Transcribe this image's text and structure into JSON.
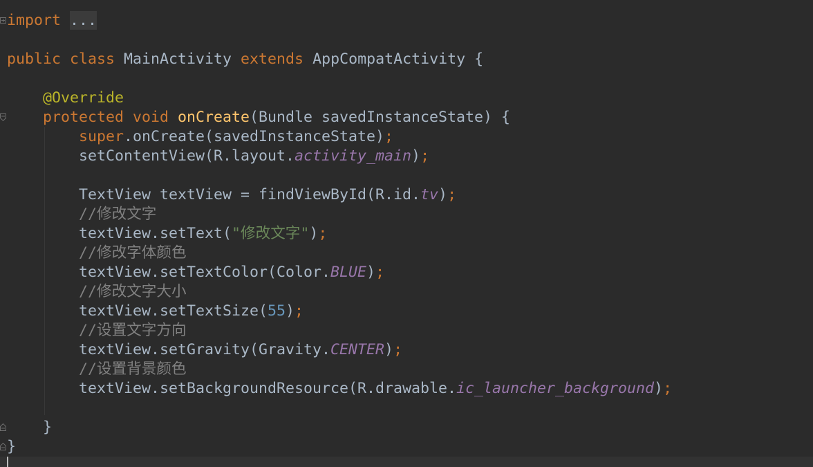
{
  "theme": {
    "background": "#2B2B2B",
    "current_line": "#323232",
    "caret": "#BBBBBB",
    "indent_guide": "#393939",
    "fold_box": "#3B3B3B",
    "gutter_icon": "#6E6E6E"
  },
  "editor": {
    "lines": [
      {
        "fold": "fold-expand-icon",
        "tokens": [
          {
            "text": "import ",
            "color": "#CC7832"
          },
          {
            "text": "...",
            "color": "#A9B7C6",
            "folded": true
          }
        ]
      },
      {
        "tokens": []
      },
      {
        "tokens": [
          {
            "text": "public ",
            "color": "#CC7832"
          },
          {
            "text": "class ",
            "color": "#CC7832"
          },
          {
            "text": "MainActivity ",
            "color": "#A9B7C6"
          },
          {
            "text": "extends ",
            "color": "#CC7832"
          },
          {
            "text": "AppCompatActivity {",
            "color": "#A9B7C6"
          }
        ]
      },
      {
        "tokens": []
      },
      {
        "tokens": [
          {
            "text": "    @Override",
            "color": "#BBB529"
          }
        ]
      },
      {
        "fold": "fold-start-icon",
        "tokens": [
          {
            "text": "    protected ",
            "color": "#CC7832"
          },
          {
            "text": "void ",
            "color": "#CC7832"
          },
          {
            "text": "onCreate",
            "color": "#FFC66D"
          },
          {
            "text": "(Bundle savedInstanceState) {",
            "color": "#A9B7C6"
          }
        ]
      },
      {
        "tokens": [
          {
            "text": "        super",
            "color": "#CC7832"
          },
          {
            "text": ".onCreate(savedInstanceState)",
            "color": "#A9B7C6"
          },
          {
            "text": ";",
            "color": "#CC7832"
          }
        ]
      },
      {
        "tokens": [
          {
            "text": "        setContentView(R.layout.",
            "color": "#A9B7C6"
          },
          {
            "text": "activity_main",
            "color": "#9876AA",
            "italic": true
          },
          {
            "text": ")",
            "color": "#A9B7C6"
          },
          {
            "text": ";",
            "color": "#CC7832"
          }
        ]
      },
      {
        "tokens": []
      },
      {
        "tokens": [
          {
            "text": "        TextView textView = findViewById(R.id.",
            "color": "#A9B7C6"
          },
          {
            "text": "tv",
            "color": "#9876AA",
            "italic": true
          },
          {
            "text": ")",
            "color": "#A9B7C6"
          },
          {
            "text": ";",
            "color": "#CC7832"
          }
        ]
      },
      {
        "tokens": [
          {
            "text": "        //修改文字",
            "color": "#808080"
          }
        ]
      },
      {
        "tokens": [
          {
            "text": "        textView.setText(",
            "color": "#A9B7C6"
          },
          {
            "text": "\"修改文字\"",
            "color": "#6A8759"
          },
          {
            "text": ")",
            "color": "#A9B7C6"
          },
          {
            "text": ";",
            "color": "#CC7832"
          }
        ]
      },
      {
        "tokens": [
          {
            "text": "        //修改字体颜色",
            "color": "#808080"
          }
        ]
      },
      {
        "tokens": [
          {
            "text": "        textView.setTextColor(Color.",
            "color": "#A9B7C6"
          },
          {
            "text": "BLUE",
            "color": "#9876AA",
            "italic": true
          },
          {
            "text": ")",
            "color": "#A9B7C6"
          },
          {
            "text": ";",
            "color": "#CC7832"
          }
        ]
      },
      {
        "tokens": [
          {
            "text": "        //修改文字大小",
            "color": "#808080"
          }
        ]
      },
      {
        "tokens": [
          {
            "text": "        textView.setTextSize(",
            "color": "#A9B7C6"
          },
          {
            "text": "55",
            "color": "#6897BB"
          },
          {
            "text": ")",
            "color": "#A9B7C6"
          },
          {
            "text": ";",
            "color": "#CC7832"
          }
        ]
      },
      {
        "tokens": [
          {
            "text": "        //设置文字方向",
            "color": "#808080"
          }
        ]
      },
      {
        "tokens": [
          {
            "text": "        textView.setGravity(Gravity.",
            "color": "#A9B7C6"
          },
          {
            "text": "CENTER",
            "color": "#9876AA",
            "italic": true
          },
          {
            "text": ")",
            "color": "#A9B7C6"
          },
          {
            "text": ";",
            "color": "#CC7832"
          }
        ]
      },
      {
        "tokens": [
          {
            "text": "        //设置背景颜色",
            "color": "#808080"
          }
        ]
      },
      {
        "tokens": [
          {
            "text": "        textView.setBackgroundResource(R.drawable.",
            "color": "#A9B7C6"
          },
          {
            "text": "ic_launcher_background",
            "color": "#9876AA",
            "italic": true
          },
          {
            "text": ")",
            "color": "#A9B7C6"
          },
          {
            "text": ";",
            "color": "#CC7832"
          }
        ]
      },
      {
        "tokens": []
      },
      {
        "fold": "fold-end-icon",
        "tokens": [
          {
            "text": "    }",
            "color": "#A9B7C6"
          }
        ]
      },
      {
        "fold": "fold-end-icon",
        "tokens": [
          {
            "text": "}",
            "color": "#A9B7C6"
          }
        ]
      }
    ]
  }
}
